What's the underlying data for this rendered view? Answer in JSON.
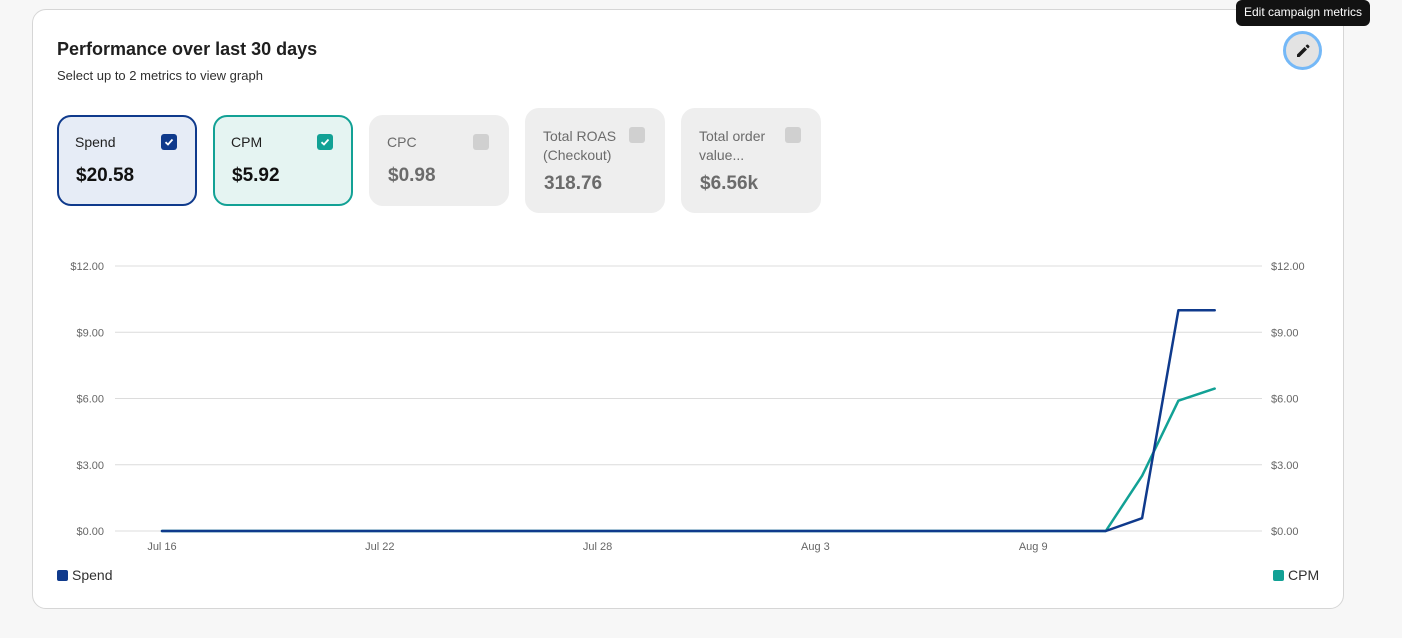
{
  "tooltip": "Edit campaign metrics",
  "header": {
    "title": "Performance over last 30 days",
    "subtitle": "Select up to 2 metrics to view graph"
  },
  "metrics": [
    {
      "label": "Spend",
      "value": "$20.58",
      "selected": true
    },
    {
      "label": "CPM",
      "value": "$5.92",
      "selected": true
    },
    {
      "label": "CPC",
      "value": "$0.98",
      "selected": false
    },
    {
      "label": "Total ROAS (Checkout)",
      "value": "318.76",
      "selected": false
    },
    {
      "label": "Total order value...",
      "value": "$6.56k",
      "selected": false
    }
  ],
  "icons": {
    "edit": "pencil-icon",
    "checked": "checkmark-icon"
  },
  "colors": {
    "spend": "#0f3a8c",
    "cpm": "#12a195",
    "grid": "#dcdcdc",
    "axis_text": "#666666",
    "edit_ring": "#74b8f7"
  },
  "chart_data": {
    "type": "line",
    "x": [
      "Jul 16",
      "Jul 17",
      "Jul 18",
      "Jul 19",
      "Jul 20",
      "Jul 21",
      "Jul 22",
      "Jul 23",
      "Jul 24",
      "Jul 25",
      "Jul 26",
      "Jul 27",
      "Jul 28",
      "Jul 29",
      "Jul 30",
      "Jul 31",
      "Aug 1",
      "Aug 2",
      "Aug 3",
      "Aug 4",
      "Aug 5",
      "Aug 6",
      "Aug 7",
      "Aug 8",
      "Aug 9",
      "Aug 10",
      "Aug 11",
      "Aug 12",
      "Aug 13",
      "Aug 14"
    ],
    "x_tick_labels": [
      "Jul 16",
      "Jul 22",
      "Jul 28",
      "Aug 3",
      "Aug 9"
    ],
    "y_tick_labels": [
      "$0.00",
      "$3.00",
      "$6.00",
      "$9.00",
      "$12.00"
    ],
    "ylim": [
      0,
      12
    ],
    "grid": true,
    "legend_placement": "bottom",
    "series": [
      {
        "name": "Spend",
        "axis": "left",
        "values": [
          0,
          0,
          0,
          0,
          0,
          0,
          0,
          0,
          0,
          0,
          0,
          0,
          0,
          0,
          0,
          0,
          0,
          0,
          0,
          0,
          0,
          0,
          0,
          0,
          0,
          0,
          0,
          0.58,
          10,
          10
        ]
      },
      {
        "name": "CPM",
        "axis": "right",
        "values": [
          0,
          0,
          0,
          0,
          0,
          0,
          0,
          0,
          0,
          0,
          0,
          0,
          0,
          0,
          0,
          0,
          0,
          0,
          0,
          0,
          0,
          0,
          0,
          0,
          0,
          0,
          0,
          2.5,
          5.9,
          6.45
        ]
      }
    ]
  }
}
